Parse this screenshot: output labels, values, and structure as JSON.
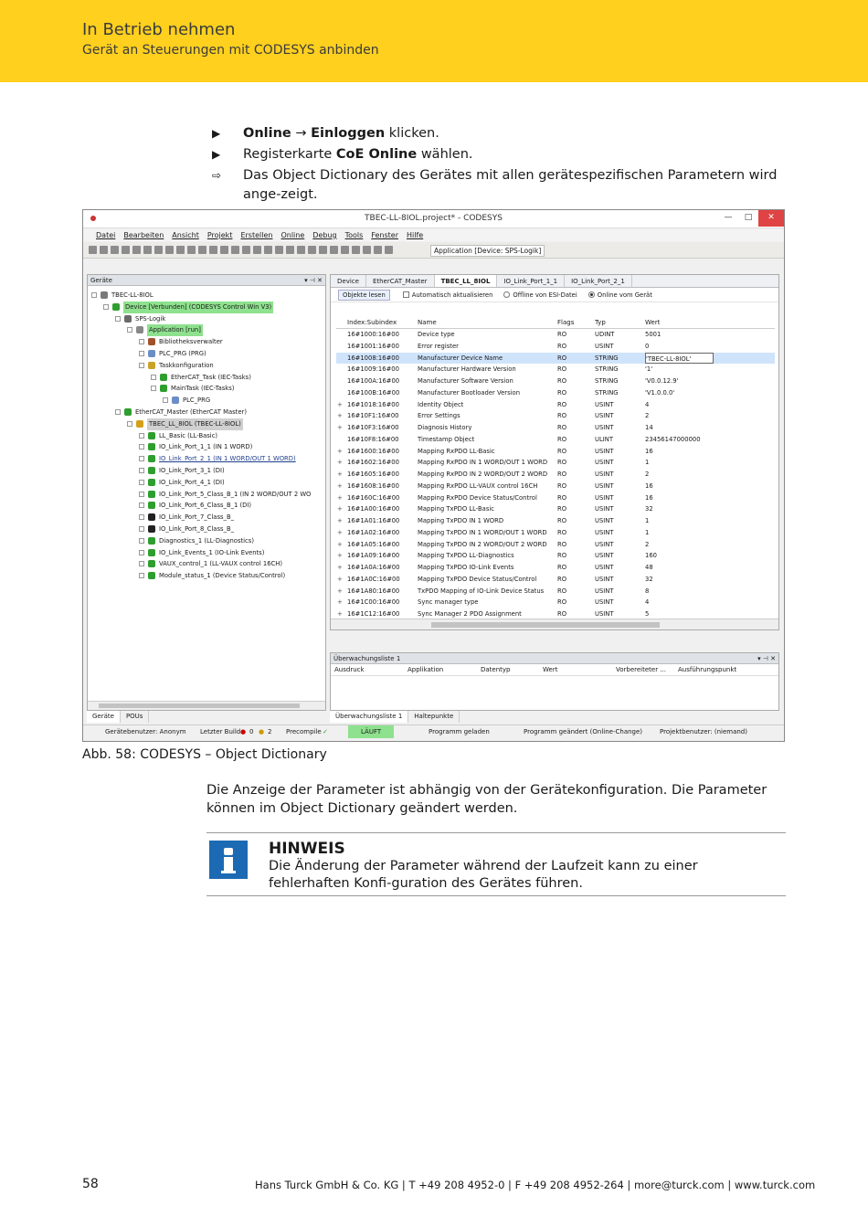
{
  "header": {
    "chapter": "In Betrieb nehmen",
    "section": "Gerät an Steuerungen mit CODESYS anbinden"
  },
  "steps": [
    {
      "marker": "▶",
      "pre": "",
      "b1": "Online",
      "mid": " → ",
      "b2": "Einloggen",
      "post": " klicken."
    },
    {
      "marker": "▶",
      "pre": "Registerkarte ",
      "b1": "CoE Online",
      "mid": "",
      "b2": "",
      "post": " wählen."
    },
    {
      "marker": "⇨",
      "pre": "Das Object Dictionary des Gerätes mit allen gerätespezifischen Parametern wird ange-zeigt.",
      "b1": "",
      "mid": "",
      "b2": "",
      "post": ""
    }
  ],
  "screenshot": {
    "window_title": "TBEC-LL-8IOL.project* - CODESYS",
    "window_buttons": [
      "—",
      "□",
      "✕"
    ],
    "menu": [
      "Datei",
      "Bearbeiten",
      "Ansicht",
      "Projekt",
      "Erstellen",
      "Online",
      "Debug",
      "Tools",
      "Fenster",
      "Hilfe"
    ],
    "toolbar_app": "Application [Device: SPS-Logik]",
    "left_panel": {
      "title": "Geräte",
      "buttons": "▾  ⊣  ✕",
      "tree": [
        {
          "label": "TBEC-LL-8IOL",
          "level": 0,
          "style": "",
          "icon": "#7a7a7a"
        },
        {
          "label": "Device [Verbunden] (CODESYS Control Win V3)",
          "level": 1,
          "style": "green",
          "icon": "#2e9e2e"
        },
        {
          "label": "SPS-Logik",
          "level": 2,
          "style": "",
          "icon": "#6a6a6a"
        },
        {
          "label": "Application [run]",
          "level": 3,
          "style": "green",
          "icon": "#888888"
        },
        {
          "label": "Bibliotheksverwalter",
          "level": 4,
          "style": "",
          "icon": "#a0522d"
        },
        {
          "label": "PLC_PRG (PRG)",
          "level": 4,
          "style": "",
          "icon": "#6b8ec7"
        },
        {
          "label": "Taskkonfiguration",
          "level": 4,
          "style": "",
          "icon": "#c9a227"
        },
        {
          "label": "EtherCAT_Task (IEC-Tasks)",
          "level": 5,
          "style": "",
          "icon": "#2e9e2e"
        },
        {
          "label": "MainTask (IEC-Tasks)",
          "level": 5,
          "style": "",
          "icon": "#2e9e2e"
        },
        {
          "label": "PLC_PRG",
          "level": 6,
          "style": "",
          "icon": "#6b8ec7"
        },
        {
          "label": "EtherCAT_Master (EtherCAT Master)",
          "level": 2,
          "style": "",
          "icon": "#2e9e2e"
        },
        {
          "label": "TBEC_LL_8IOL (TBEC-LL-8IOL)",
          "level": 3,
          "style": "grey",
          "icon": "#d4a017"
        },
        {
          "label": "LL_Basic (LL-Basic)",
          "level": 4,
          "style": "",
          "icon": "#2e9e2e"
        },
        {
          "label": "IO_Link_Port_1_1 (IN 1 WORD)",
          "level": 4,
          "style": "",
          "icon": "#2e9e2e"
        },
        {
          "label": "IO_Link_Port_2_1 (IN 1 WORD/OUT 1 WORD)",
          "level": 4,
          "style": "sel",
          "icon": "#2e9e2e"
        },
        {
          "label": "IO_Link_Port_3_1 (DI)",
          "level": 4,
          "style": "",
          "icon": "#2e9e2e"
        },
        {
          "label": "IO_Link_Port_4_1 (DI)",
          "level": 4,
          "style": "",
          "icon": "#2e9e2e"
        },
        {
          "label": "IO_Link_Port_5_Class_B_1 (IN 2 WORD/OUT 2 WO",
          "level": 4,
          "style": "",
          "icon": "#2e9e2e"
        },
        {
          "label": "IO_Link_Port_6_Class_B_1 (DI)",
          "level": 4,
          "style": "",
          "icon": "#2e9e2e"
        },
        {
          "label": "IO_Link_Port_7_Class_B_",
          "level": 4,
          "style": "",
          "icon": "#222222"
        },
        {
          "label": "IO_Link_Port_8_Class_B_",
          "level": 4,
          "style": "",
          "icon": "#222222"
        },
        {
          "label": "Diagnostics_1 (LL-Diagnostics)",
          "level": 4,
          "style": "",
          "icon": "#2e9e2e"
        },
        {
          "label": "IO_Link_Events_1 (IO-Link Events)",
          "level": 4,
          "style": "",
          "icon": "#2e9e2e"
        },
        {
          "label": "VAUX_control_1 (LL-VAUX control 16CH)",
          "level": 4,
          "style": "",
          "icon": "#2e9e2e"
        },
        {
          "label": "Module_status_1 (Device Status/Control)",
          "level": 4,
          "style": "",
          "icon": "#2e9e2e"
        }
      ],
      "tabs": [
        "Geräte",
        "POUs"
      ]
    },
    "doc_tabs": [
      "Device",
      "EtherCAT_Master",
      "TBEC_LL_8IOL",
      "IO_Link_Port_1_1",
      "IO_Link_Port_2_1"
    ],
    "subbar": {
      "button": "Objekte lesen",
      "auto": "Automatisch aktualisieren",
      "offline": "Offline von ESI-Datei",
      "online": "Online vom Gerät"
    },
    "table": {
      "headers": [
        "Index:Subindex",
        "Name",
        "Flags",
        "Typ",
        "Wert"
      ],
      "rows": [
        {
          "idx": "16#1000:16#00",
          "name": "Device type",
          "flags": "RO",
          "typ": "UDINT",
          "val": "5001",
          "plus": ""
        },
        {
          "idx": "16#1001:16#00",
          "name": "Error register",
          "flags": "RO",
          "typ": "USINT",
          "val": "0",
          "plus": ""
        },
        {
          "idx": "16#1008:16#00",
          "name": "Manufacturer Device Name",
          "flags": "RO",
          "typ": "STRING",
          "val": "'TBEC-LL-8IOL'",
          "plus": "",
          "hl": true
        },
        {
          "idx": "16#1009:16#00",
          "name": "Manufacturer Hardware Version",
          "flags": "RO",
          "typ": "STRING",
          "val": "'1'",
          "plus": ""
        },
        {
          "idx": "16#100A:16#00",
          "name": "Manufacturer Software Version",
          "flags": "RO",
          "typ": "STRING",
          "val": "'V0.0.12.9'",
          "plus": ""
        },
        {
          "idx": "16#100B:16#00",
          "name": "Manufacturer Bootloader Version",
          "flags": "RO",
          "typ": "STRING",
          "val": "'V1.0.0.0'",
          "plus": ""
        },
        {
          "idx": "16#1018:16#00",
          "name": "Identity Object",
          "flags": "RO",
          "typ": "USINT",
          "val": "4",
          "plus": "+"
        },
        {
          "idx": "16#10F1:16#00",
          "name": "Error Settings",
          "flags": "RO",
          "typ": "USINT",
          "val": "2",
          "plus": "+"
        },
        {
          "idx": "16#10F3:16#00",
          "name": "Diagnosis History",
          "flags": "RO",
          "typ": "USINT",
          "val": "14",
          "plus": "+"
        },
        {
          "idx": "16#10F8:16#00",
          "name": "Timestamp Object",
          "flags": "RO",
          "typ": "ULINT",
          "val": "23456147000000",
          "plus": ""
        },
        {
          "idx": "16#1600:16#00",
          "name": "Mapping RxPDO LL-Basic",
          "flags": "RO",
          "typ": "USINT",
          "val": "16",
          "plus": "+"
        },
        {
          "idx": "16#1602:16#00",
          "name": "Mapping RxPDO IN 1 WORD/OUT 1 WORD",
          "flags": "RO",
          "typ": "USINT",
          "val": "1",
          "plus": "+"
        },
        {
          "idx": "16#1605:16#00",
          "name": "Mapping RxPDO IN 2 WORD/OUT 2 WORD",
          "flags": "RO",
          "typ": "USINT",
          "val": "2",
          "plus": "+"
        },
        {
          "idx": "16#1608:16#00",
          "name": "Mapping RxPDO LL-VAUX control 16CH",
          "flags": "RO",
          "typ": "USINT",
          "val": "16",
          "plus": "+"
        },
        {
          "idx": "16#160C:16#00",
          "name": "Mapping RxPDO Device Status/Control",
          "flags": "RO",
          "typ": "USINT",
          "val": "16",
          "plus": "+"
        },
        {
          "idx": "16#1A00:16#00",
          "name": "Mapping TxPDO LL-Basic",
          "flags": "RO",
          "typ": "USINT",
          "val": "32",
          "plus": "+"
        },
        {
          "idx": "16#1A01:16#00",
          "name": "Mapping TxPDO IN 1 WORD",
          "flags": "RO",
          "typ": "USINT",
          "val": "1",
          "plus": "+"
        },
        {
          "idx": "16#1A02:16#00",
          "name": "Mapping TxPDO IN 1 WORD/OUT 1 WORD",
          "flags": "RO",
          "typ": "USINT",
          "val": "1",
          "plus": "+"
        },
        {
          "idx": "16#1A05:16#00",
          "name": "Mapping TxPDO IN 2 WORD/OUT 2 WORD",
          "flags": "RO",
          "typ": "USINT",
          "val": "2",
          "plus": "+"
        },
        {
          "idx": "16#1A09:16#00",
          "name": "Mapping TxPDO LL-Diagnostics",
          "flags": "RO",
          "typ": "USINT",
          "val": "160",
          "plus": "+"
        },
        {
          "idx": "16#1A0A:16#00",
          "name": "Mapping TxPDO IO-Link Events",
          "flags": "RO",
          "typ": "USINT",
          "val": "48",
          "plus": "+"
        },
        {
          "idx": "16#1A0C:16#00",
          "name": "Mapping TxPDO Device Status/Control",
          "flags": "RO",
          "typ": "USINT",
          "val": "32",
          "plus": "+"
        },
        {
          "idx": "16#1A80:16#00",
          "name": "TxPDO Mapping of IO-Link Device Status",
          "flags": "RO",
          "typ": "USINT",
          "val": "8",
          "plus": "+"
        },
        {
          "idx": "16#1C00:16#00",
          "name": "Sync manager type",
          "flags": "RO",
          "typ": "USINT",
          "val": "4",
          "plus": "+"
        },
        {
          "idx": "16#1C12:16#00",
          "name": "Sync Manager 2 PDO Assignment",
          "flags": "RO",
          "typ": "USINT",
          "val": "5",
          "plus": "+"
        }
      ]
    },
    "watch": {
      "title": "Überwachungsliste 1",
      "buttons": "▾  ⊣  ✕",
      "headers": [
        "Ausdruck",
        "Applikation",
        "Datentyp",
        "Wert",
        "Vorbereiteter ...",
        "Ausführungspunkt"
      ]
    },
    "bottom_tabs": [
      "Überwachungsliste 1",
      "Haltepunkte"
    ],
    "status": {
      "user": "Gerätebenutzer: Anonym",
      "build": "Letzter Build",
      "errors": "0",
      "warnings": "2",
      "precompile": "Precompile",
      "state": "LÄUFT",
      "program": "Programm geladen",
      "changed": "Programm geändert (Online-Change)",
      "project_user": "Projektbenutzer: (niemand)"
    }
  },
  "caption": "Abb. 58: CODESYS – Object Dictionary",
  "paragraph": "Die Anzeige der Parameter ist abhängig von der Gerätekonfiguration. Die Parameter können im Object Dictionary geändert werden.",
  "notice": {
    "title": "HINWEIS",
    "text": "Die Änderung der Parameter während der Laufzeit kann zu einer fehlerhaften Konfi-guration des Gerätes führen.",
    "icon": "info-icon",
    "color": "#1c6ab3"
  },
  "footer": {
    "page": "58",
    "company": "Hans Turck GmbH & Co. KG | T +49 208 4952-0 | F +49 208 4952-264 | more@turck.com | www.turck.com"
  }
}
